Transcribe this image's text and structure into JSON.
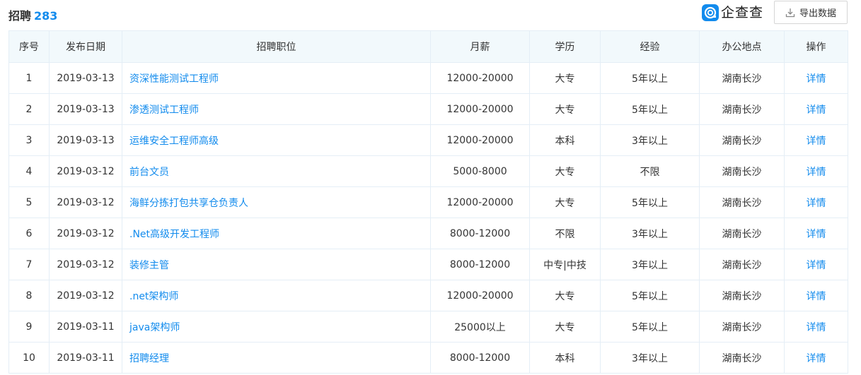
{
  "header": {
    "title": "招聘",
    "count": "283",
    "brand_text": "企查查",
    "export_label": "导出数据"
  },
  "table": {
    "columns": [
      "序号",
      "发布日期",
      "招聘职位",
      "月薪",
      "学历",
      "经验",
      "办公地点",
      "操作"
    ],
    "rows": [
      {
        "no": "1",
        "date": "2019-03-13",
        "position": "资深性能测试工程师",
        "salary": "12000-20000",
        "edu": "大专",
        "exp": "5年以上",
        "location": "湖南长沙",
        "action": "详情"
      },
      {
        "no": "2",
        "date": "2019-03-13",
        "position": "渗透测试工程师",
        "salary": "12000-20000",
        "edu": "大专",
        "exp": "5年以上",
        "location": "湖南长沙",
        "action": "详情"
      },
      {
        "no": "3",
        "date": "2019-03-13",
        "position": "运维安全工程师高级",
        "salary": "12000-20000",
        "edu": "本科",
        "exp": "3年以上",
        "location": "湖南长沙",
        "action": "详情"
      },
      {
        "no": "4",
        "date": "2019-03-12",
        "position": "前台文员",
        "salary": "5000-8000",
        "edu": "大专",
        "exp": "不限",
        "location": "湖南长沙",
        "action": "详情"
      },
      {
        "no": "5",
        "date": "2019-03-12",
        "position": "海鲜分拣打包共享仓负责人",
        "salary": "12000-20000",
        "edu": "大专",
        "exp": "5年以上",
        "location": "湖南长沙",
        "action": "详情"
      },
      {
        "no": "6",
        "date": "2019-03-12",
        "position": ".Net高级开发工程师",
        "salary": "8000-12000",
        "edu": "不限",
        "exp": "3年以上",
        "location": "湖南长沙",
        "action": "详情"
      },
      {
        "no": "7",
        "date": "2019-03-12",
        "position": "装修主管",
        "salary": "8000-12000",
        "edu": "中专|中技",
        "exp": "3年以上",
        "location": "湖南长沙",
        "action": "详情"
      },
      {
        "no": "8",
        "date": "2019-03-12",
        "position": ".net架构师",
        "salary": "12000-20000",
        "edu": "大专",
        "exp": "5年以上",
        "location": "湖南长沙",
        "action": "详情"
      },
      {
        "no": "9",
        "date": "2019-03-11",
        "position": "java架构师",
        "salary": "25000以上",
        "edu": "大专",
        "exp": "5年以上",
        "location": "湖南长沙",
        "action": "详情"
      },
      {
        "no": "10",
        "date": "2019-03-11",
        "position": "招聘经理",
        "salary": "8000-12000",
        "edu": "本科",
        "exp": "3年以上",
        "location": "湖南长沙",
        "action": "详情"
      }
    ]
  },
  "colors": {
    "accent": "#128bed",
    "header_bg": "#f2f9fc",
    "border": "#e4eef6"
  },
  "icons": {
    "brand": "qcc-logo-icon",
    "export": "download-icon"
  }
}
